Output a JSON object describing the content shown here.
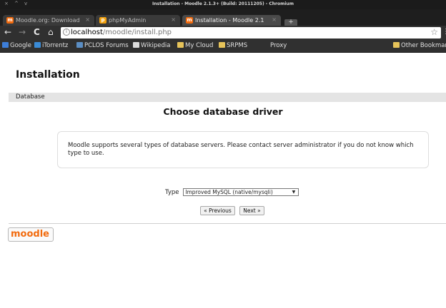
{
  "window": {
    "title": "Installation - Moodle 2.1.3+ (Build: 20111205) - Chromium",
    "controls": [
      "×",
      "^",
      "v"
    ]
  },
  "tabs": [
    {
      "label": "Moodle.org: Download",
      "close": "×"
    },
    {
      "label": "phpMyAdmin",
      "close": "×"
    },
    {
      "label": "Installation - Moodle 2.1",
      "close": "×"
    }
  ],
  "newtab": "+",
  "toolbar": {
    "back": "←",
    "forward": "→",
    "reload": "C",
    "home": "⌂",
    "url_host": "localhost",
    "url_path": "/moodle/install.php",
    "star": "☆",
    "wrench": "⋮"
  },
  "bookmarks": [
    {
      "label": "Google"
    },
    {
      "label": "iTorrentz"
    },
    {
      "label": "PCLOS Forums"
    },
    {
      "label": "Wikipedia"
    },
    {
      "label": "My Cloud"
    },
    {
      "label": "SRPMS"
    },
    {
      "label": "Proxy"
    }
  ],
  "other_bookmarks": "Other Bookmarks",
  "page": {
    "heading": "Installation",
    "navbar": "Database",
    "step_heading": "Choose database driver",
    "notice": "Moodle supports several types of database servers. Please contact server administrator if you do not know which type to use.",
    "type_label": "Type",
    "type_selected": "Improved MySQL (native/mysqli)",
    "prev_button": "« Previous",
    "next_button": "Next »",
    "logo_text": "moodle"
  },
  "colors": {
    "accent": "#f26b0e",
    "navbar_bg": "#e4e4e4",
    "chrome_dark": "#303030"
  }
}
